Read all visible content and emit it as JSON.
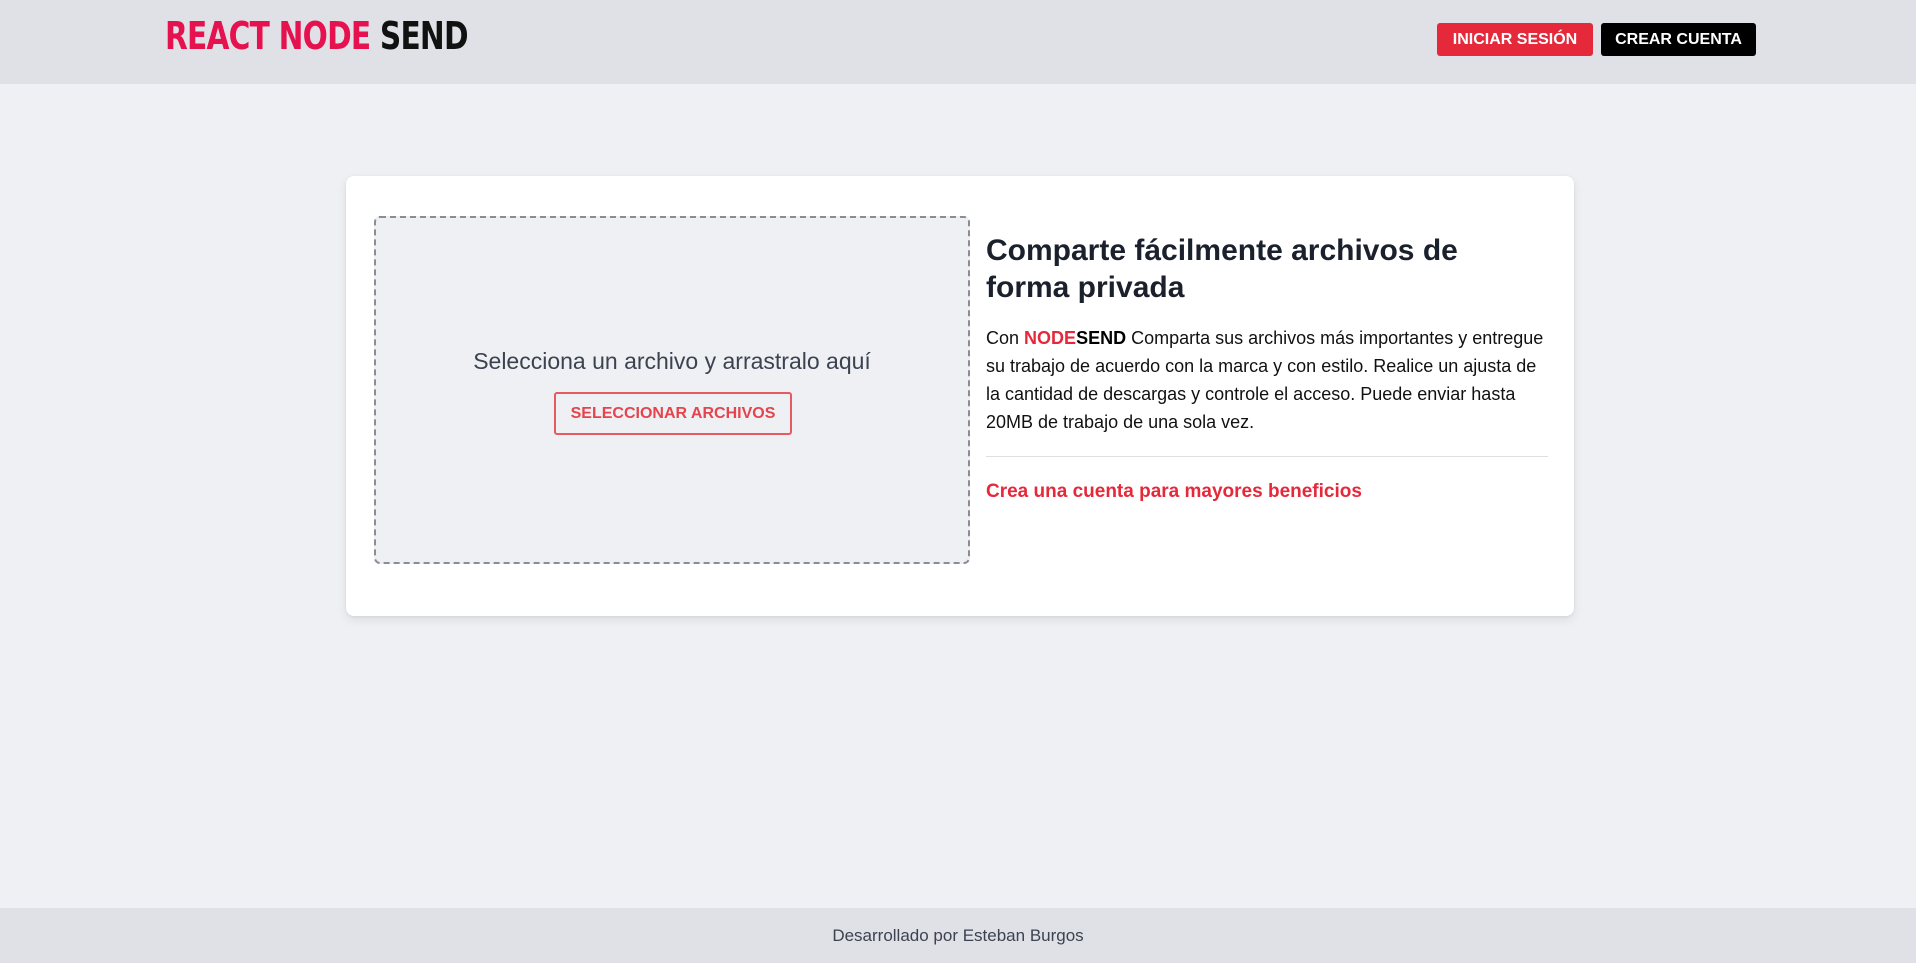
{
  "header": {
    "logo": {
      "part1": "REACT NODE",
      "part2": "SEND"
    },
    "login_label": "Iniciar Sesión",
    "register_label": "Crear Cuenta"
  },
  "upload": {
    "instruction": "Selecciona un archivo y arrastralo aquí",
    "select_button_label": "Seleccionar Archivos"
  },
  "info": {
    "title": "Comparte fácilmente archivos de forma privada",
    "intro_prefix": "Con",
    "brand_node": "NODE",
    "brand_send": "SEND",
    "description": "Comparta sus archivos más importantes y entregue su trabajo de acuerdo con la marca y con estilo. Realice un ajusta de la cantidad de descargas y controle el acceso. Puede enviar hasta 20MB de trabajo de una sola vez.",
    "cta_link": "Crea una cuenta para mayores beneficios"
  },
  "footer": {
    "credit": "Desarrollado por Esteban Burgos"
  },
  "colors": {
    "accent_red": "#e5293b",
    "logo_red": "#e6114f",
    "header_bg": "#e0e1e6",
    "page_bg": "#eff0f4"
  }
}
